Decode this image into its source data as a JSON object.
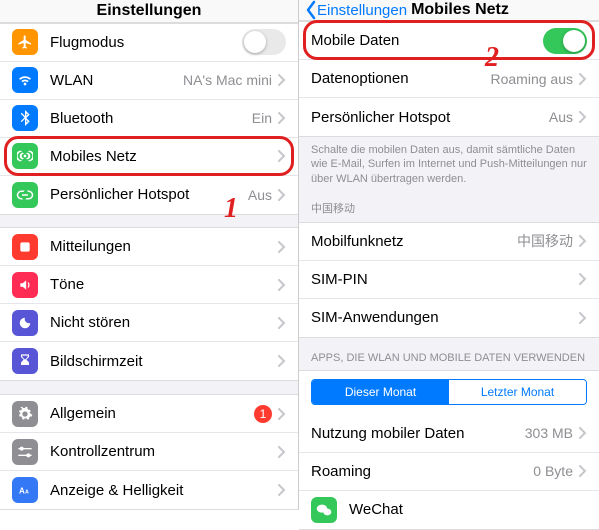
{
  "left": {
    "title": "Einstellungen",
    "group1": [
      {
        "name": "airplane",
        "label": "Flugmodus",
        "toggle": "off"
      },
      {
        "name": "wlan",
        "label": "WLAN",
        "value": "NA's Mac mini"
      },
      {
        "name": "bluetooth",
        "label": "Bluetooth",
        "value": "Ein"
      },
      {
        "name": "cellular",
        "label": "Mobiles Netz",
        "highlighted": true
      },
      {
        "name": "hotspot",
        "label": "Persönlicher Hotspot",
        "value": "Aus"
      }
    ],
    "group2": [
      {
        "name": "notifications",
        "label": "Mitteilungen"
      },
      {
        "name": "sounds",
        "label": "Töne"
      },
      {
        "name": "dnd",
        "label": "Nicht stören"
      },
      {
        "name": "screentime",
        "label": "Bildschirmzeit"
      }
    ],
    "group3": [
      {
        "name": "general",
        "label": "Allgemein",
        "badge": "1"
      },
      {
        "name": "controlcenter",
        "label": "Kontrollzentrum"
      },
      {
        "name": "display",
        "label": "Anzeige & Helligkeit"
      }
    ],
    "step_number": "1"
  },
  "right": {
    "back": "Einstellungen",
    "title": "Mobiles Netz",
    "group1": [
      {
        "name": "mobile-data",
        "label": "Mobile Daten",
        "toggle": "on",
        "highlighted": true
      },
      {
        "name": "data-options",
        "label": "Datenoptionen",
        "value": "Roaming aus"
      },
      {
        "name": "personal-hotspot",
        "label": "Persönlicher Hotspot",
        "value": "Aus"
      }
    ],
    "footer1": "Schalte die mobilen Daten aus, damit sämtliche Daten wie E-Mail, Surfen im Internet und Push-Mitteilungen nur über WLAN übertragen werden.",
    "carrier_header": "中国移动",
    "group2": [
      {
        "name": "network",
        "label": "Mobilfunknetz",
        "value": "中国移动"
      },
      {
        "name": "sim-pin",
        "label": "SIM-PIN"
      },
      {
        "name": "sim-apps",
        "label": "SIM-Anwendungen"
      }
    ],
    "apps_header": "APPS, DIE WLAN UND MOBILE DATEN VERWENDEN",
    "segmented": {
      "a": "Dieser Monat",
      "b": "Letzter Monat"
    },
    "group3": [
      {
        "name": "usage",
        "label": "Nutzung mobiler Daten",
        "value": "303 MB"
      },
      {
        "name": "roaming",
        "label": "Roaming",
        "value": "0 Byte"
      },
      {
        "name": "wechat",
        "label": "WeChat"
      }
    ],
    "step_number": "2"
  }
}
